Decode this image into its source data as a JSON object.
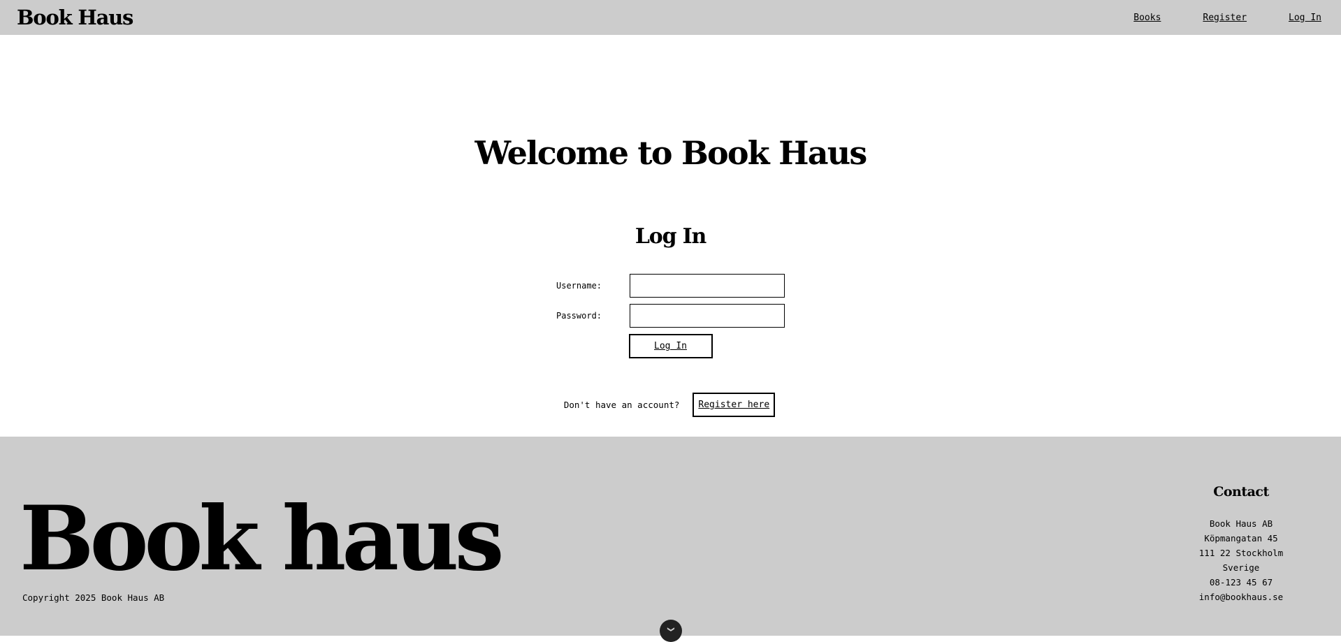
{
  "header": {
    "brand": "Book Haus",
    "nav": [
      {
        "label": "Books"
      },
      {
        "label": "Register"
      },
      {
        "label": "Log In"
      }
    ]
  },
  "main": {
    "welcome": "Welcome to Book Haus",
    "login_heading": "Log In",
    "username_label": "Username:",
    "username_value": "",
    "password_label": "Password:",
    "password_value": "",
    "login_button": "Log In",
    "no_account_text": "Don't have an account?",
    "register_button": "Register here"
  },
  "footer": {
    "logo": "Book haus",
    "copyright": "Copyright 2025 Book Haus AB",
    "contact": {
      "heading": "Contact",
      "lines": [
        "Book Haus AB",
        "Köpmangatan 45",
        "111 22 Stockholm",
        "Sverige",
        "08-123 45 67",
        "info@bookhaus.se"
      ]
    },
    "scroll_icon": "chevron-down-icon"
  },
  "colors": {
    "header_bg": "#cccccc",
    "footer_bg": "#cccccc",
    "page_bg": "#ffffff",
    "text": "#000000"
  }
}
